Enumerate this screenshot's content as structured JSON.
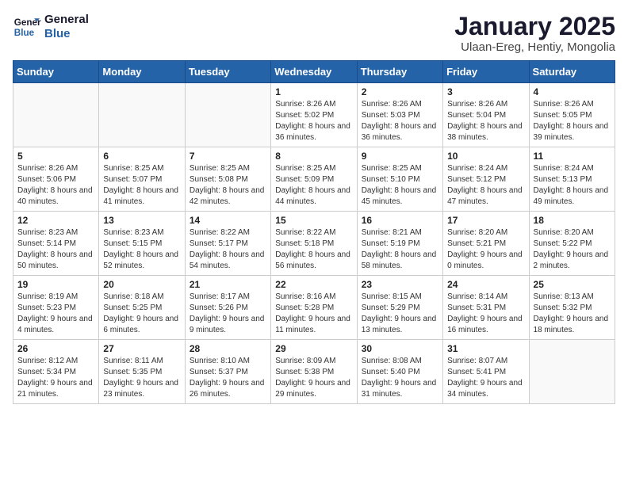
{
  "logo": {
    "line1": "General",
    "line2": "Blue"
  },
  "title": "January 2025",
  "subtitle": "Ulaan-Ereg, Hentiy, Mongolia",
  "weekdays": [
    "Sunday",
    "Monday",
    "Tuesday",
    "Wednesday",
    "Thursday",
    "Friday",
    "Saturday"
  ],
  "weeks": [
    [
      {
        "day": "",
        "info": ""
      },
      {
        "day": "",
        "info": ""
      },
      {
        "day": "",
        "info": ""
      },
      {
        "day": "1",
        "info": "Sunrise: 8:26 AM\nSunset: 5:02 PM\nDaylight: 8 hours and 36 minutes."
      },
      {
        "day": "2",
        "info": "Sunrise: 8:26 AM\nSunset: 5:03 PM\nDaylight: 8 hours and 36 minutes."
      },
      {
        "day": "3",
        "info": "Sunrise: 8:26 AM\nSunset: 5:04 PM\nDaylight: 8 hours and 38 minutes."
      },
      {
        "day": "4",
        "info": "Sunrise: 8:26 AM\nSunset: 5:05 PM\nDaylight: 8 hours and 39 minutes."
      }
    ],
    [
      {
        "day": "5",
        "info": "Sunrise: 8:26 AM\nSunset: 5:06 PM\nDaylight: 8 hours and 40 minutes."
      },
      {
        "day": "6",
        "info": "Sunrise: 8:25 AM\nSunset: 5:07 PM\nDaylight: 8 hours and 41 minutes."
      },
      {
        "day": "7",
        "info": "Sunrise: 8:25 AM\nSunset: 5:08 PM\nDaylight: 8 hours and 42 minutes."
      },
      {
        "day": "8",
        "info": "Sunrise: 8:25 AM\nSunset: 5:09 PM\nDaylight: 8 hours and 44 minutes."
      },
      {
        "day": "9",
        "info": "Sunrise: 8:25 AM\nSunset: 5:10 PM\nDaylight: 8 hours and 45 minutes."
      },
      {
        "day": "10",
        "info": "Sunrise: 8:24 AM\nSunset: 5:12 PM\nDaylight: 8 hours and 47 minutes."
      },
      {
        "day": "11",
        "info": "Sunrise: 8:24 AM\nSunset: 5:13 PM\nDaylight: 8 hours and 49 minutes."
      }
    ],
    [
      {
        "day": "12",
        "info": "Sunrise: 8:23 AM\nSunset: 5:14 PM\nDaylight: 8 hours and 50 minutes."
      },
      {
        "day": "13",
        "info": "Sunrise: 8:23 AM\nSunset: 5:15 PM\nDaylight: 8 hours and 52 minutes."
      },
      {
        "day": "14",
        "info": "Sunrise: 8:22 AM\nSunset: 5:17 PM\nDaylight: 8 hours and 54 minutes."
      },
      {
        "day": "15",
        "info": "Sunrise: 8:22 AM\nSunset: 5:18 PM\nDaylight: 8 hours and 56 minutes."
      },
      {
        "day": "16",
        "info": "Sunrise: 8:21 AM\nSunset: 5:19 PM\nDaylight: 8 hours and 58 minutes."
      },
      {
        "day": "17",
        "info": "Sunrise: 8:20 AM\nSunset: 5:21 PM\nDaylight: 9 hours and 0 minutes."
      },
      {
        "day": "18",
        "info": "Sunrise: 8:20 AM\nSunset: 5:22 PM\nDaylight: 9 hours and 2 minutes."
      }
    ],
    [
      {
        "day": "19",
        "info": "Sunrise: 8:19 AM\nSunset: 5:23 PM\nDaylight: 9 hours and 4 minutes."
      },
      {
        "day": "20",
        "info": "Sunrise: 8:18 AM\nSunset: 5:25 PM\nDaylight: 9 hours and 6 minutes."
      },
      {
        "day": "21",
        "info": "Sunrise: 8:17 AM\nSunset: 5:26 PM\nDaylight: 9 hours and 9 minutes."
      },
      {
        "day": "22",
        "info": "Sunrise: 8:16 AM\nSunset: 5:28 PM\nDaylight: 9 hours and 11 minutes."
      },
      {
        "day": "23",
        "info": "Sunrise: 8:15 AM\nSunset: 5:29 PM\nDaylight: 9 hours and 13 minutes."
      },
      {
        "day": "24",
        "info": "Sunrise: 8:14 AM\nSunset: 5:31 PM\nDaylight: 9 hours and 16 minutes."
      },
      {
        "day": "25",
        "info": "Sunrise: 8:13 AM\nSunset: 5:32 PM\nDaylight: 9 hours and 18 minutes."
      }
    ],
    [
      {
        "day": "26",
        "info": "Sunrise: 8:12 AM\nSunset: 5:34 PM\nDaylight: 9 hours and 21 minutes."
      },
      {
        "day": "27",
        "info": "Sunrise: 8:11 AM\nSunset: 5:35 PM\nDaylight: 9 hours and 23 minutes."
      },
      {
        "day": "28",
        "info": "Sunrise: 8:10 AM\nSunset: 5:37 PM\nDaylight: 9 hours and 26 minutes."
      },
      {
        "day": "29",
        "info": "Sunrise: 8:09 AM\nSunset: 5:38 PM\nDaylight: 9 hours and 29 minutes."
      },
      {
        "day": "30",
        "info": "Sunrise: 8:08 AM\nSunset: 5:40 PM\nDaylight: 9 hours and 31 minutes."
      },
      {
        "day": "31",
        "info": "Sunrise: 8:07 AM\nSunset: 5:41 PM\nDaylight: 9 hours and 34 minutes."
      },
      {
        "day": "",
        "info": ""
      }
    ]
  ]
}
